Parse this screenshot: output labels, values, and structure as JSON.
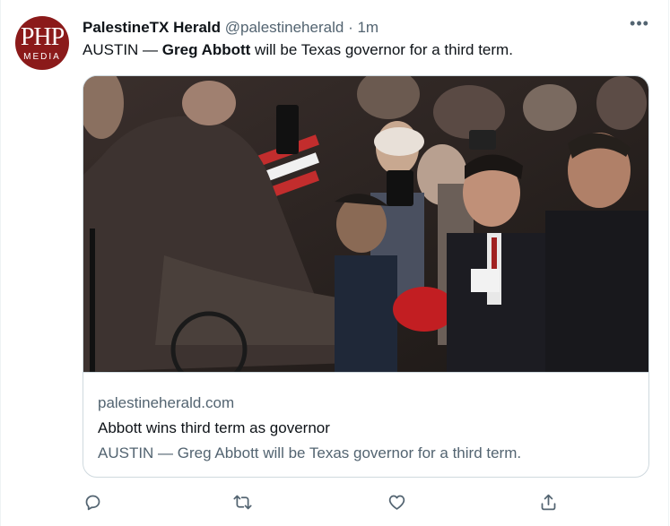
{
  "tweet": {
    "display_name": "PalestineTX Herald",
    "handle": "@palestineherald",
    "separator": "·",
    "timestamp": "1m",
    "text_prefix": "AUSTIN — ",
    "text_bold": "Greg Abbott",
    "text_suffix": " will be Texas governor for a third term."
  },
  "avatar": {
    "line1": "PHP",
    "line2": "MEDIA",
    "color": "#8b1a1a"
  },
  "more_menu": {
    "icon": "more-dots-icon",
    "glyph": "•••"
  },
  "card": {
    "image_icon": "news-photo",
    "domain": "palestineherald.com",
    "title": "Abbott wins third term as governor",
    "description": "AUSTIN — Greg Abbott will be Texas governor for a third term."
  },
  "actions": {
    "reply_icon": "reply-icon",
    "retweet_icon": "retweet-icon",
    "like_icon": "like-icon",
    "share_icon": "share-icon"
  },
  "colors": {
    "text": "#0f1419",
    "muted": "#536471",
    "border": "#cfd9de"
  }
}
